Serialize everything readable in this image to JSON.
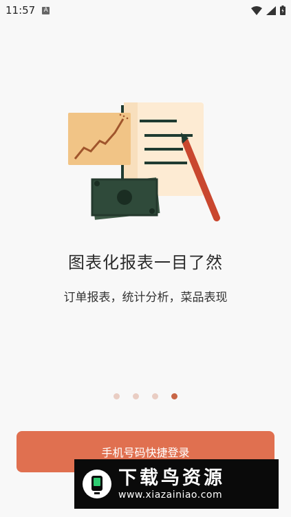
{
  "status_bar": {
    "time": "11:57",
    "notification": "A"
  },
  "onboarding": {
    "title": "图表化报表一目了然",
    "subtitle": "订单报表，统计分析，菜品表现",
    "page_count": 4,
    "current_page": 4
  },
  "login_button": {
    "label": "手机号码快捷登录"
  },
  "watermark": {
    "name": "下载鸟资源",
    "url": "www.xiazainiao.com"
  },
  "colors": {
    "accent": "#e07050",
    "dot_active": "#c86646",
    "dot_inactive": "#e9cdc3"
  }
}
